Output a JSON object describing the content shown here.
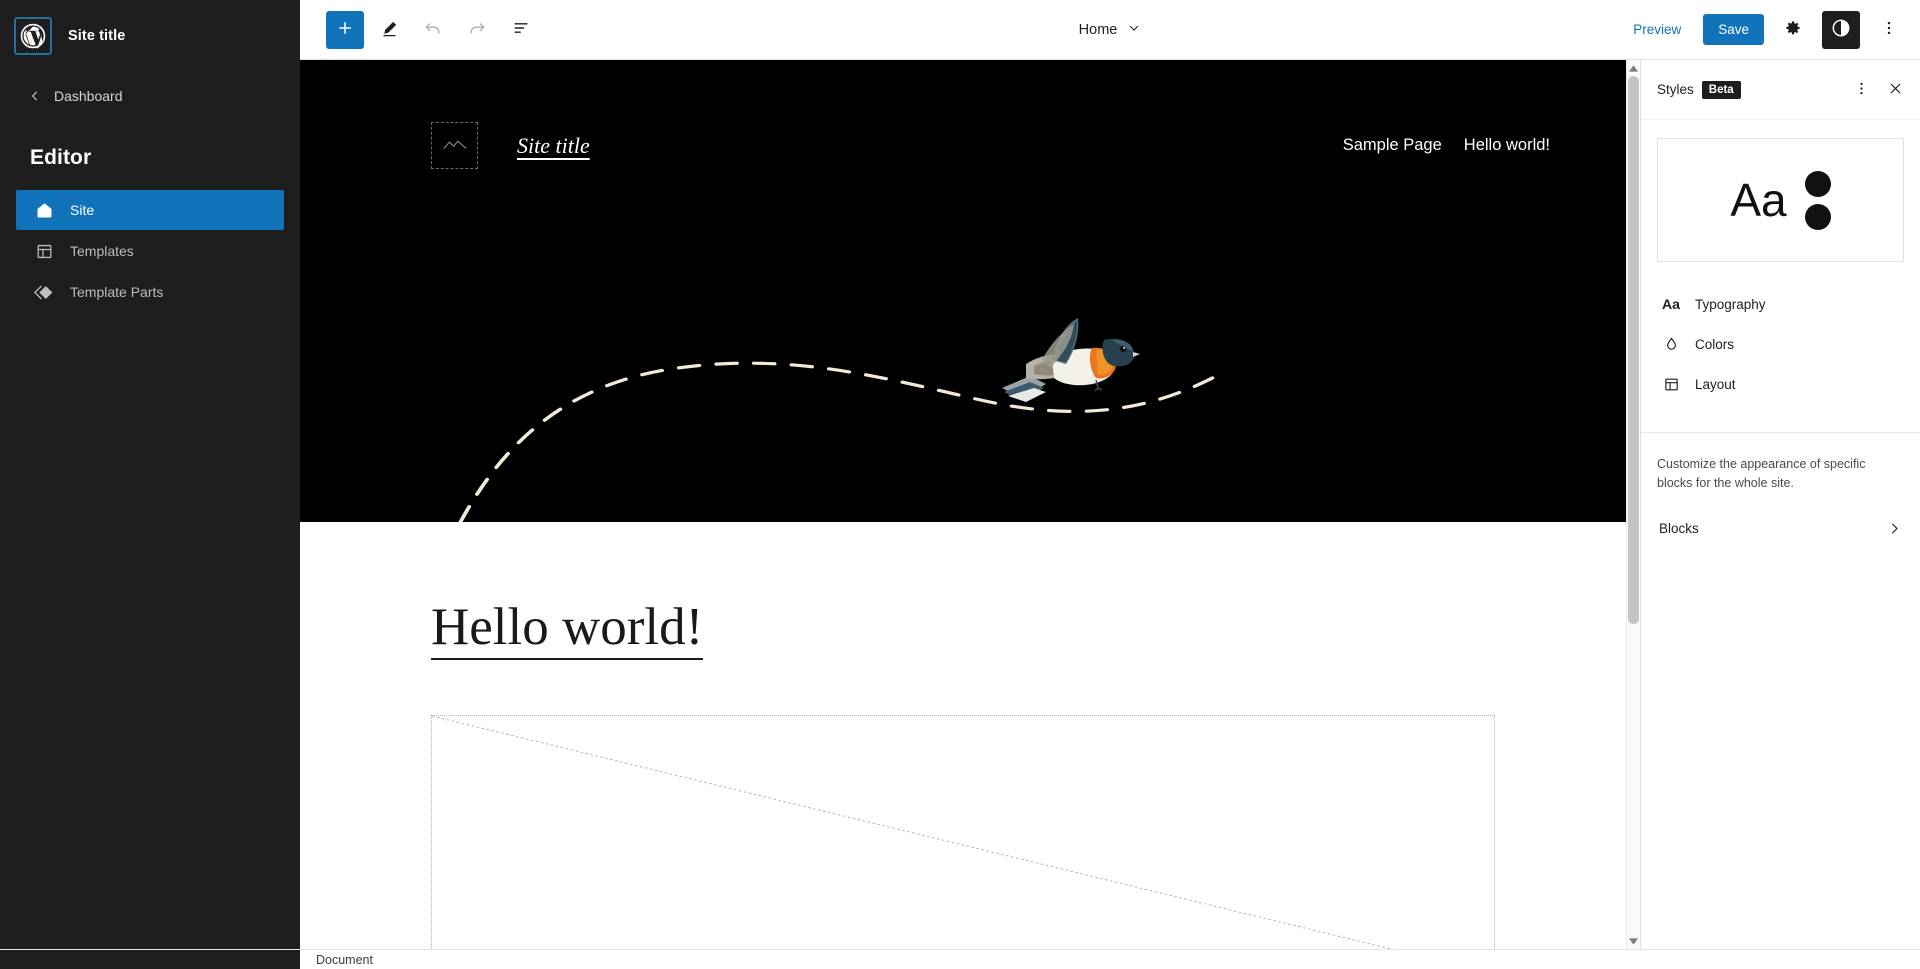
{
  "sidebar": {
    "logo_icon": "wordpress-logo-icon",
    "site_title": "Site title",
    "back_label": "Dashboard",
    "back_icon": "chevron-left-icon",
    "section_title": "Editor",
    "items": [
      {
        "label": "Site",
        "icon": "home-icon",
        "active": true
      },
      {
        "label": "Templates",
        "icon": "layout-template-icon",
        "active": false
      },
      {
        "label": "Template Parts",
        "icon": "diamond-icon",
        "active": false
      }
    ]
  },
  "toolbar": {
    "add_block_icon": "plus-icon",
    "add_block_label": "+",
    "tools_icon": "pencil-icon",
    "undo_icon": "undo-arrow-icon",
    "redo_icon": "redo-arrow-icon",
    "list_view_icon": "list-view-icon",
    "document_name": "Home",
    "document_chevron_icon": "chevron-down-icon",
    "preview_label": "Preview",
    "save_label": "Save",
    "settings_icon": "gear-icon",
    "styles_icon": "contrast-half-circle-icon",
    "more_icon": "kebab-menu-icon"
  },
  "canvas": {
    "hero": {
      "logo_placeholder_icon": "image-placeholder-icon",
      "site_title": "Site title",
      "nav_links": [
        "Sample Page",
        "Hello world!"
      ],
      "background_color": "#000000",
      "curve_color": "#f2ead9",
      "bird_image_alt": "flying-bird-illustration"
    },
    "content": {
      "post_title": "Hello world!",
      "image_block_placeholder": "image-block-placeholder"
    },
    "scrollbar": {
      "up_icon": "scroll-up-arrow-icon",
      "down_icon": "scroll-down-arrow-icon",
      "thumb_position_percent": 0
    }
  },
  "styles_panel": {
    "title": "Styles",
    "badge": "Beta",
    "more_icon": "kebab-menu-icon",
    "close_icon": "close-x-icon",
    "preview": {
      "sample_text": "Aa",
      "swatch_colors": [
        "#111111",
        "#111111"
      ]
    },
    "menu": [
      {
        "label": "Typography",
        "icon": "aa-typography-icon"
      },
      {
        "label": "Colors",
        "icon": "droplet-icon"
      },
      {
        "label": "Layout",
        "icon": "layout-icon"
      }
    ],
    "description": "Customize the appearance of specific blocks for the whole site.",
    "blocks_label": "Blocks",
    "blocks_chevron_icon": "chevron-right-icon"
  },
  "statusbar": {
    "label": "Document"
  },
  "colors": {
    "accent": "#1174ba",
    "sidebar_bg": "#1e1e1e",
    "hero_bg": "#000000"
  }
}
